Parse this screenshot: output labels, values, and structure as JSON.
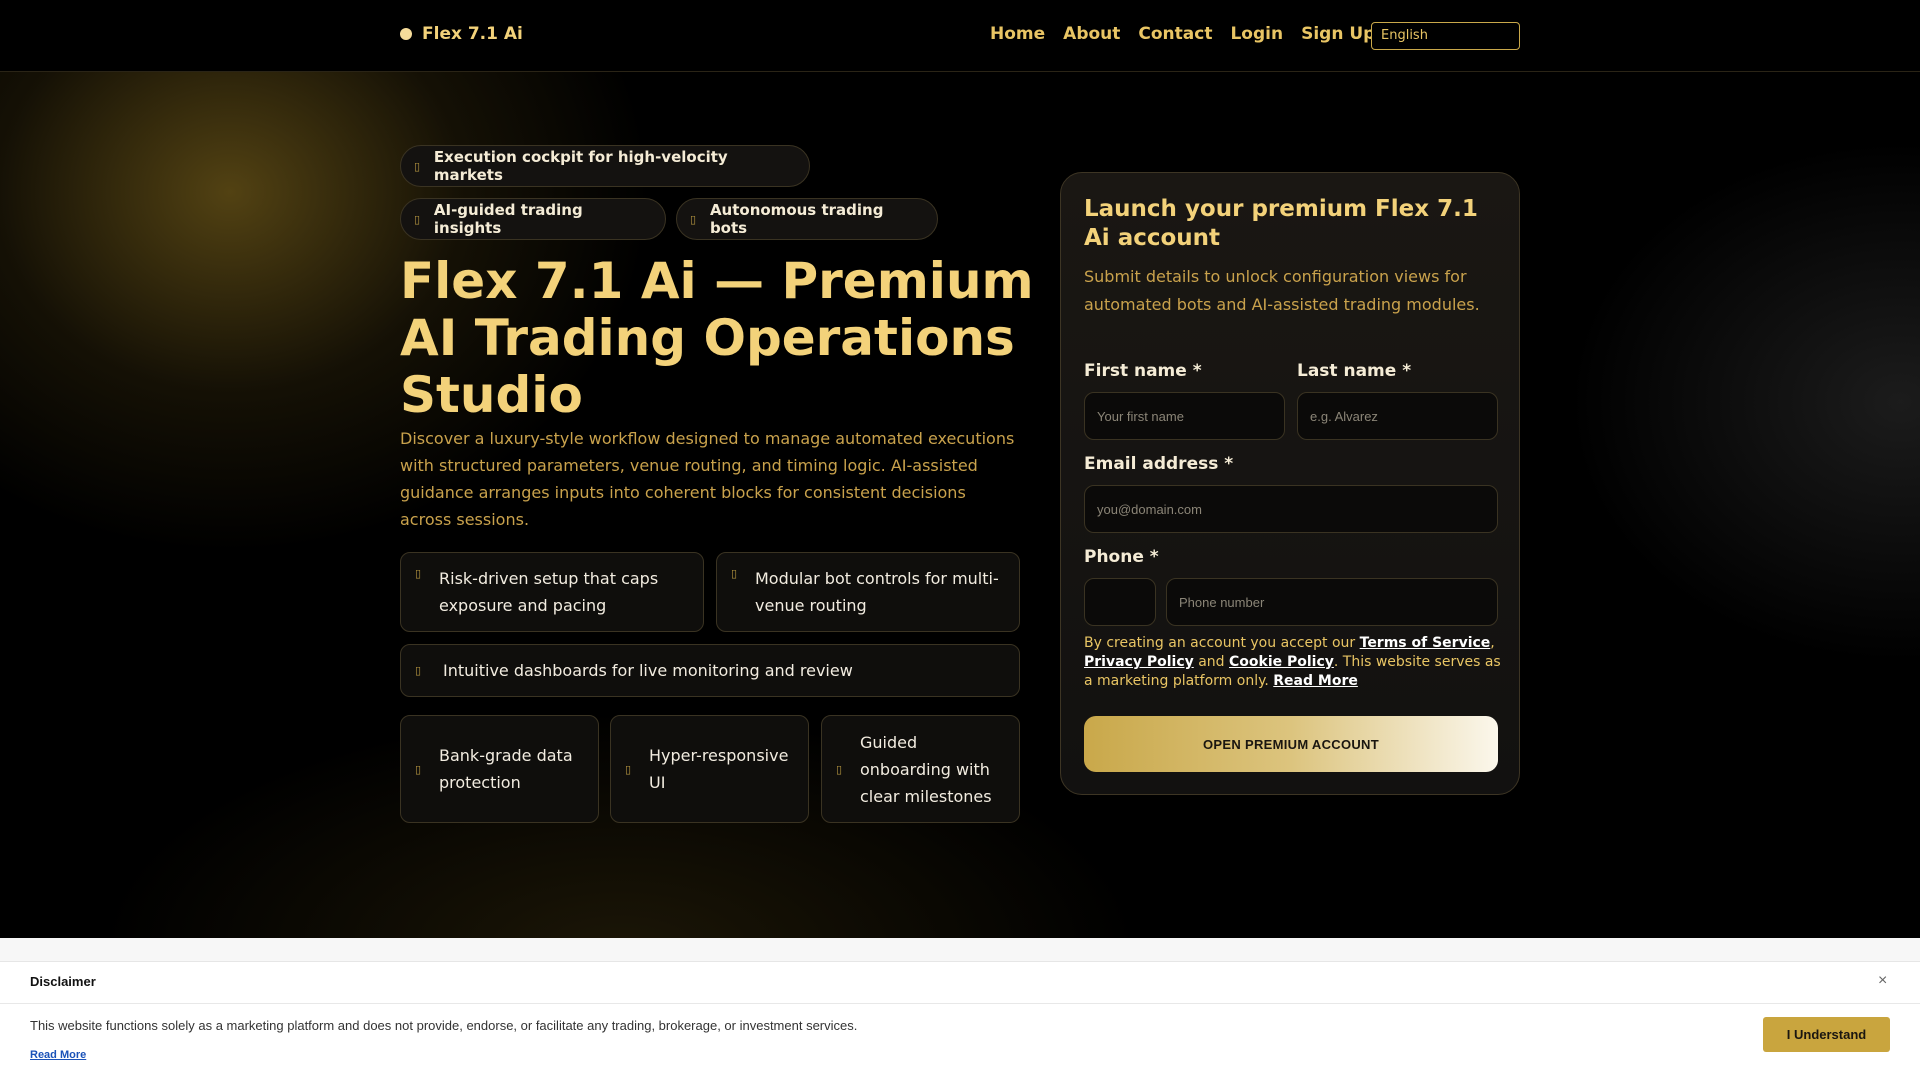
{
  "header": {
    "brand": "Flex 7.1 Ai",
    "nav": [
      "Home",
      "About",
      "Contact",
      "Login",
      "Sign Up"
    ],
    "language": "English"
  },
  "hero": {
    "badges": [
      "Execution cockpit for high-velocity markets",
      "AI-guided trading insights",
      "Autonomous trading bots"
    ],
    "title": "Flex 7.1 Ai — Premium AI Trading Operations Studio",
    "description": "Discover a luxury-style workflow designed to manage automated executions with structured parameters, venue routing, and timing logic. AI-assisted guidance arranges inputs into coherent blocks for consistent decisions across sessions.",
    "features": [
      "Risk-driven setup that caps exposure and pacing",
      "Modular bot controls for multi-venue routing",
      "Intuitive dashboards for live monitoring and review"
    ],
    "highlights": [
      "Bank-grade data protection",
      "Hyper-responsive UI",
      "Guided onboarding with clear milestones"
    ]
  },
  "form": {
    "title": "Launch your premium Flex 7.1 Ai account",
    "subtitle": "Submit details to unlock configuration views for automated bots and AI-assisted trading modules.",
    "first_name_label": "First name *",
    "first_name_placeholder": "Your first name",
    "last_name_label": "Last name *",
    "last_name_placeholder": "e.g. Alvarez",
    "email_label": "Email address *",
    "email_placeholder": "you@domain.com",
    "phone_label": "Phone *",
    "phone_code_value": "",
    "phone_placeholder": "Phone number",
    "legal_prefix": "By creating an account you accept our ",
    "terms": "Terms of Service",
    "comma": ",",
    "privacy": "Privacy Policy",
    "and": " and ",
    "cookie": "Cookie Policy",
    "legal_suffix": ". This website serves as a marketing platform only. ",
    "read_more": "Read More",
    "submit": "OPEN PREMIUM ACCOUNT"
  },
  "disclaimer": {
    "title": "Disclaimer",
    "close": "×",
    "text": "This website functions solely as a marketing platform and does not provide, endorse, or facilitate any trading, brokerage, or investment services.",
    "read_more": "Read More",
    "button": "I Understand"
  },
  "colors": {
    "accent": "#f3d27a",
    "gold": "#c9a84a",
    "background": "#000000"
  },
  "icons": {
    "badge": "bullet-icon",
    "feature": "bullet-icon"
  }
}
